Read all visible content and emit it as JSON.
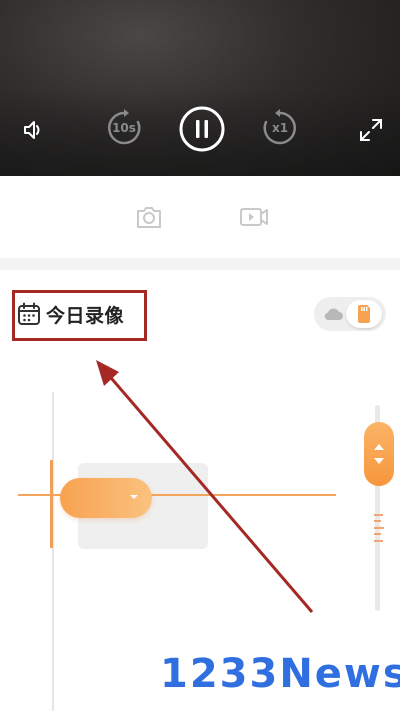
{
  "player": {
    "rewind_label": "10s",
    "speed_label": "x1"
  },
  "recordings": {
    "header_label": "今日录像"
  },
  "colors": {
    "accent": "#f7a251",
    "annotation": "#a52824",
    "watermark": "#2f6fe0"
  },
  "icons": {
    "volume": "speaker-icon",
    "rewind": "rewind-10s-icon",
    "pause": "pause-icon",
    "speed": "playback-speed-icon",
    "fullscreen": "fullscreen-icon",
    "snapshot": "camera-icon",
    "record": "video-record-icon",
    "calendar": "calendar-icon",
    "cloud": "cloud-icon",
    "sdcard": "sd-card-icon"
  },
  "watermark": {
    "text": "1233News"
  }
}
